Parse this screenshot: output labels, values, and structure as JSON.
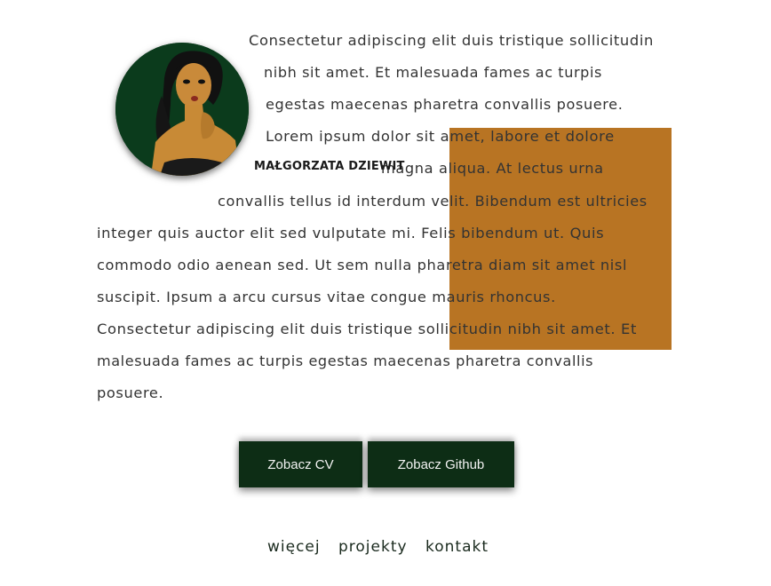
{
  "profile": {
    "name": "Małgorzata Dziewit",
    "avatar_icon": "portrait-illustration-icon"
  },
  "bio_lines": [
    "Consectetur adipiscing elit duis tristique sollicitudin",
    "nibh sit amet. Et malesuada fames ac turpis",
    "egestas maecenas pharetra convallis posuere.",
    "Lorem ipsum dolor sit amet, labore et dolore",
    "magna aliqua. At lectus urna",
    "convallis tellus id interdum velit. Bibendum est ultricies",
    "integer quis auctor elit sed vulputate mi. Felis bibendum ut. Quis",
    "commodo odio aenean sed. Ut sem nulla pharetra diam sit amet nisl",
    "suscipit. Ipsum a arcu cursus vitae congue mauris rhoncus.",
    "Consectetur adipiscing elit duis tristique sollicitudin nibh sit amet. Et",
    "malesuada fames ac turpis egestas maecenas pharetra convallis",
    "posuere."
  ],
  "buttons": {
    "cv_label": "Zobacz CV",
    "github_label": "Zobacz Github"
  },
  "nav": {
    "more": "więcej",
    "projects": "projekty",
    "contact": "kontakt"
  },
  "colors": {
    "accent_block": "#b87423",
    "button_bg": "#0d2d15",
    "avatar_bg": "#0b3b1c"
  }
}
